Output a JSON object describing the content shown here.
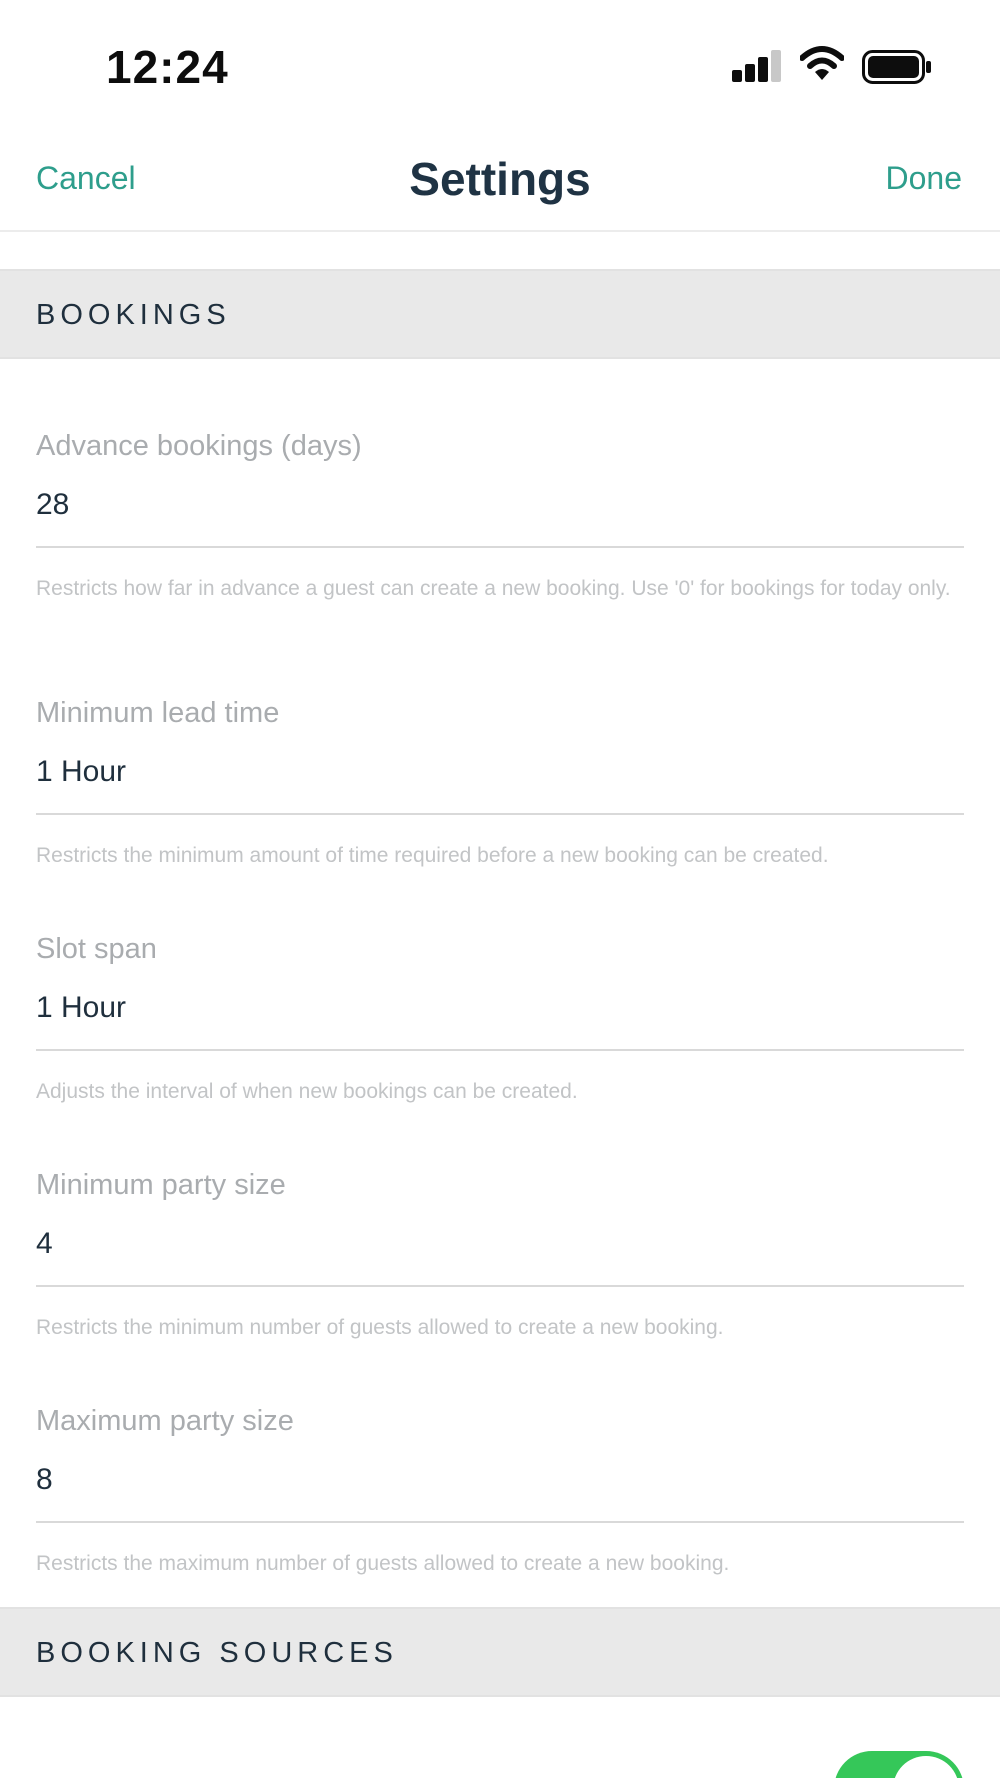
{
  "status_bar": {
    "time": "12:24"
  },
  "nav": {
    "cancel_label": "Cancel",
    "title": "Settings",
    "done_label": "Done"
  },
  "sections": {
    "bookings": "BOOKINGS",
    "booking_sources": "BOOKING SOURCES"
  },
  "fields": [
    {
      "label": "Advance bookings (days)",
      "value": "28",
      "help": "Restricts how far in advance a guest can create a new booking. Use '0' for bookings for today only."
    },
    {
      "label": "Minimum lead time",
      "value": "1 Hour",
      "help": "Restricts the minimum amount of time required before a new booking can be created."
    },
    {
      "label": "Slot span",
      "value": "1 Hour",
      "help": "Adjusts the interval of when new bookings can be created."
    },
    {
      "label": "Minimum party size",
      "value": "4",
      "help": "Restricts the minimum number of guests allowed to create a new booking."
    },
    {
      "label": "Maximum party size",
      "value": "8",
      "help": "Restricts the maximum number of guests allowed to create a new booking."
    }
  ],
  "toggle": {
    "state": "on",
    "color": "#35c759"
  },
  "icons": [
    "signal-icon",
    "wifi-icon",
    "battery-icon"
  ],
  "colors": {
    "accent": "#2e9e8c",
    "section_bg": "#e9e9e9",
    "title": "#1f3344"
  }
}
